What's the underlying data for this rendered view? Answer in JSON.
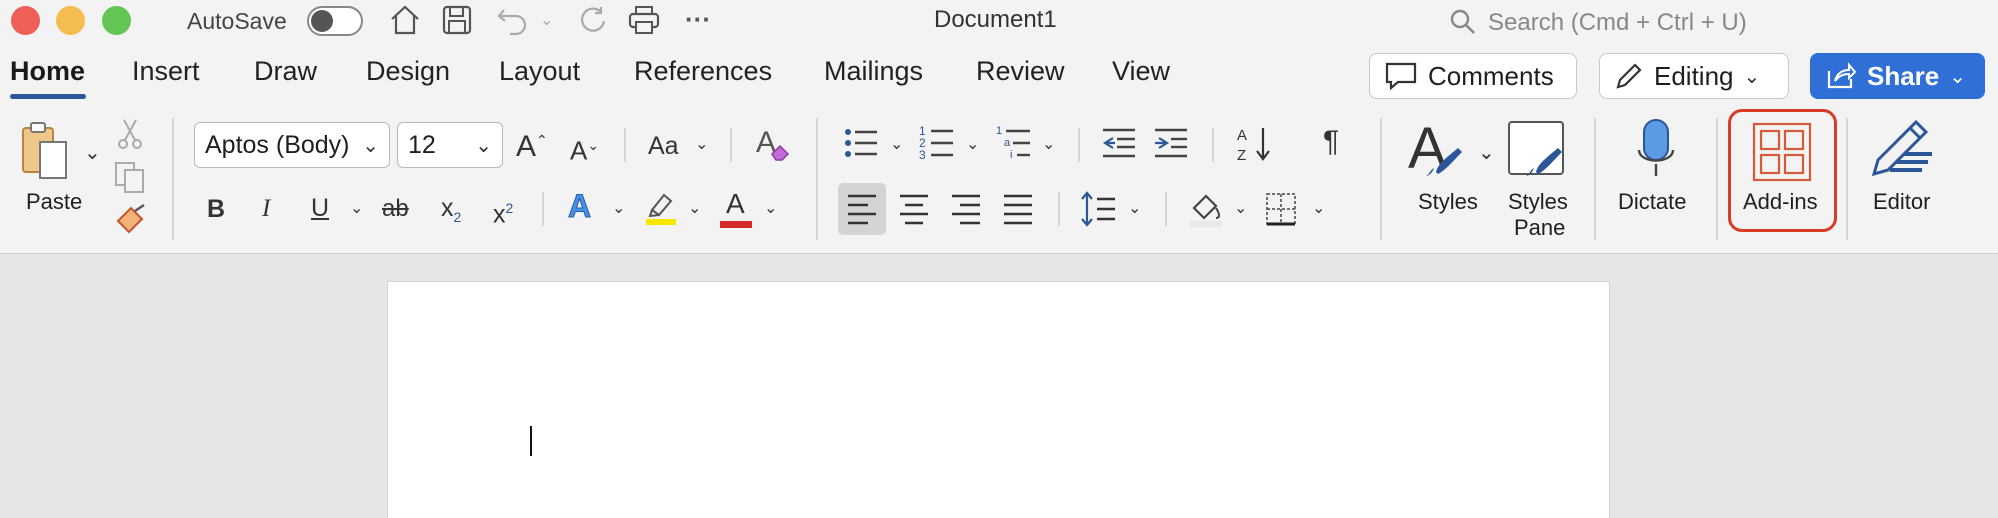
{
  "window": {
    "title": "Document1"
  },
  "titlebar": {
    "autosave_label": "AutoSave",
    "search_placeholder": "Search (Cmd + Ctrl + U)",
    "more": "···"
  },
  "tabs": [
    "Home",
    "Insert",
    "Draw",
    "Design",
    "Layout",
    "References",
    "Mailings",
    "Review",
    "View"
  ],
  "header_buttons": {
    "comments": "Comments",
    "editing": "Editing",
    "share": "Share"
  },
  "ribbon": {
    "paste_label": "Paste",
    "font_name": "Aptos (Body)",
    "font_size": "12",
    "grow_font": "A",
    "shrink_font": "A",
    "change_case": "Aa",
    "bold": "B",
    "italic": "I",
    "underline": "U",
    "strikethrough": "ab",
    "subscript": "x",
    "superscript": "x",
    "text_effects": "A",
    "font_color": "A",
    "styles_label": "Styles",
    "styles_pane_label_1": "Styles",
    "styles_pane_label_2": "Pane",
    "dictate_label": "Dictate",
    "addins_label": "Add-ins",
    "editor_label": "Editor"
  },
  "colors": {
    "accent": "#2b579a",
    "share_bg": "#2f6fd6",
    "highlight_yellow": "#f7e600",
    "font_red": "#d42a2a",
    "addins_outline": "#d83b28",
    "addins_icon": "#d45a3a"
  }
}
